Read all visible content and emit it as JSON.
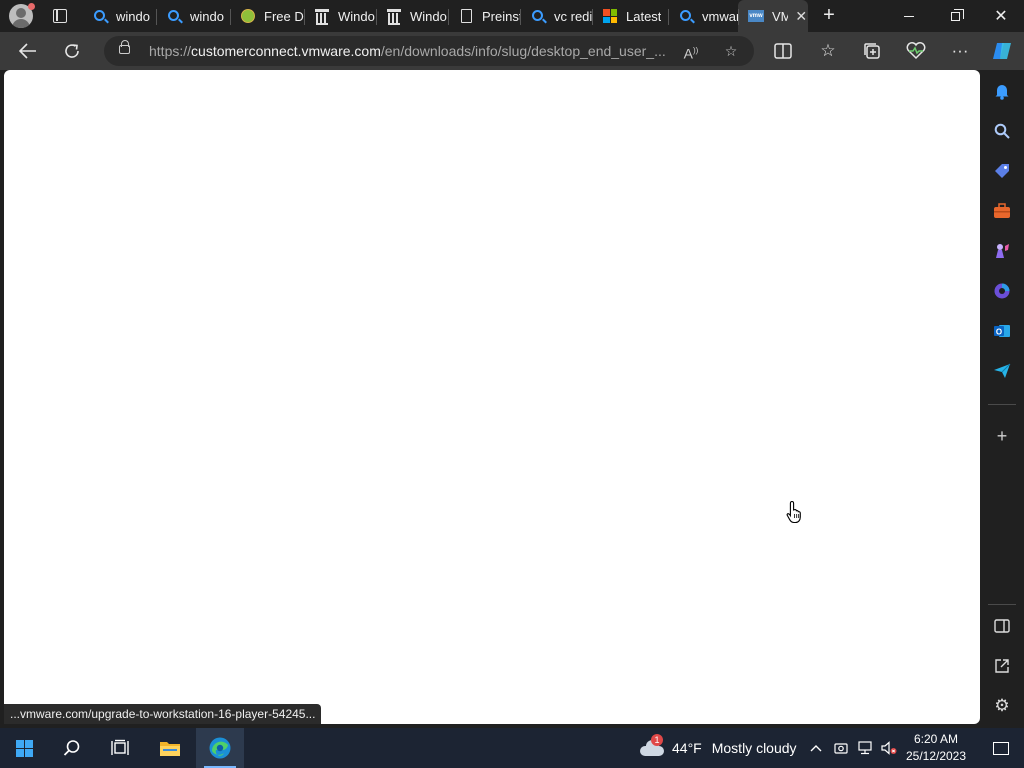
{
  "browser": {
    "tabs": [
      {
        "title": "windo",
        "favicon": "search-icon"
      },
      {
        "title": "windo",
        "favicon": "search-icon"
      },
      {
        "title": "Free D",
        "favicon": "free-download-icon"
      },
      {
        "title": "Windo",
        "favicon": "museum-icon"
      },
      {
        "title": "Windo",
        "favicon": "museum-icon"
      },
      {
        "title": "Preinst",
        "favicon": "page-icon"
      },
      {
        "title": "vc redi",
        "favicon": "search-icon"
      },
      {
        "title": "Latest",
        "favicon": "microsoft-icon"
      },
      {
        "title": "vmwar",
        "favicon": "search-icon"
      },
      {
        "title": "VM",
        "favicon": "vmware-icon",
        "active": true
      }
    ],
    "vmware_favicon_text": "vmw",
    "address": {
      "prefix": "https://",
      "domain": "customerconnect.vmware.com",
      "path": "/en/downloads/info/slug/desktop_end_user_..."
    },
    "status_url": "...vmware.com/upgrade-to-workstation-16-player-54245..."
  },
  "taskbar": {
    "weather": {
      "temp": "44°F",
      "condition": "Mostly cloudy",
      "badge": "1"
    },
    "clock": {
      "time": "6:20 AM",
      "date": "25/12/2023"
    }
  },
  "colors": {
    "accent": "#3b9cff",
    "page_bg": "#ffffff",
    "chrome_bg": "#202020",
    "toolbar_bg": "#3a3a3a",
    "taskbar_bg": "#1c2433"
  }
}
